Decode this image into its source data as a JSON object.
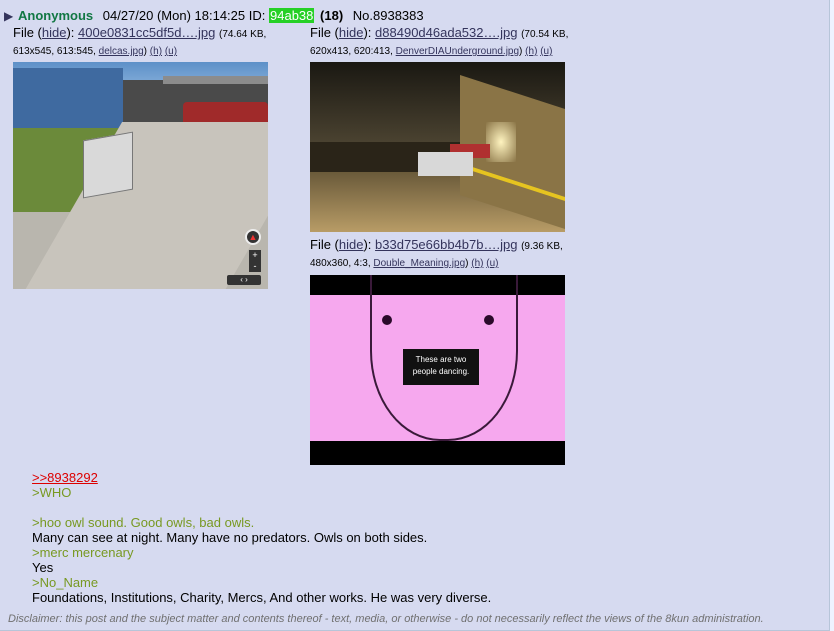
{
  "post": {
    "arrow": "▶",
    "name": "Anonymous",
    "date": "04/27/20 (Mon) 18:14:25",
    "id_label": "ID:",
    "id_value": "94ab38",
    "reply_count": "(18)",
    "number": "No.8938383"
  },
  "files": [
    {
      "label": "File (",
      "hide": "hide",
      "sep": "):",
      "name": "400e0831cc5df5d….jpg",
      "size": "(74.64 KB,",
      "meta": "613x545, 613:545,",
      "orig": "delcas.jpg",
      "h": "(h)",
      "u": "(u)",
      "close": ")"
    },
    {
      "label": "File (",
      "hide": "hide",
      "sep": "):",
      "name": "d88490d46ada532….jpg",
      "size": "(70.54 KB,",
      "meta": "620x413, 620:413,",
      "orig": "DenverDIAUnderground.jpg",
      "h": "(h)",
      "u": "(u)",
      "close": ")"
    },
    {
      "label": "File (",
      "hide": "hide",
      "sep": "):",
      "name": "b33d75e66bb4b7b….jpg",
      "size": "(9.36 KB,",
      "meta": "480x360, 4:3,",
      "orig": "Double_Meaning.jpg",
      "h": "(h)",
      "u": "(u)",
      "close": ")"
    }
  ],
  "thumb3_caption": "These are two people dancing.",
  "streetview": {
    "zoom_in": "+",
    "zoom_out": "-",
    "pan": "‹ ›"
  },
  "body": [
    {
      "type": "link",
      "text": ">>8938292"
    },
    {
      "type": "quote",
      "text": ">WHO"
    },
    {
      "type": "blank",
      "text": ""
    },
    {
      "type": "quote",
      "text": ">hoo owl sound. Good owls, bad owls."
    },
    {
      "type": "text",
      "text": "Many can see at night. Many have no predators. Owls on both sides."
    },
    {
      "type": "quote",
      "text": ">merc mercenary"
    },
    {
      "type": "text",
      "text": "Yes"
    },
    {
      "type": "quote",
      "text": ">No_Name"
    },
    {
      "type": "text",
      "text": "Foundations, Institutions, Charity, Mercs, And other works. He was very diverse."
    }
  ],
  "disclaimer": "Disclaimer: this post and the subject matter and contents thereof - text, media, or otherwise - do not necessarily reflect the views of the 8kun administration."
}
